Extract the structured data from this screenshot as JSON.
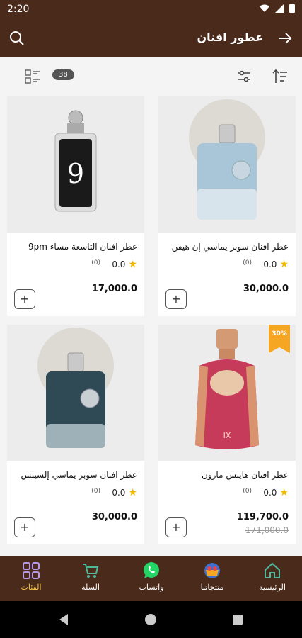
{
  "status_bar": {
    "time": "2:20"
  },
  "app_bar": {
    "title": "عطور افنان"
  },
  "toolbar": {
    "count": "38"
  },
  "products": [
    {
      "name": "عطر افنان سوبر يماسي إن هيفن",
      "rating": "0.0",
      "reviews": "(0)",
      "price": "30,000.0"
    },
    {
      "name": "عطر افنان التاسعة مساء 9pm",
      "rating": "0.0",
      "reviews": "(0)",
      "price": "17,000.0"
    },
    {
      "name": "عطر افنان هاينس مارون",
      "rating": "0.0",
      "reviews": "(0)",
      "price": "119,700.0",
      "old_price": "171,000.0",
      "discount": "30%"
    },
    {
      "name": "عطر افنان سوبر يماسي إلسينس",
      "rating": "0.0",
      "reviews": "(0)",
      "price": "30,000.0"
    }
  ],
  "bottom_nav": [
    {
      "label": "الرئيسية",
      "icon": "home-icon"
    },
    {
      "label": "منتجاتنا",
      "icon": "products-icon"
    },
    {
      "label": "واتساب",
      "icon": "whatsapp-icon"
    },
    {
      "label": "السلة",
      "icon": "cart-icon"
    },
    {
      "label": "الفئات",
      "icon": "categories-icon"
    }
  ],
  "colors": {
    "brand": "#4a2a1a",
    "accent": "#f5c542",
    "discount": "#f5a623"
  }
}
